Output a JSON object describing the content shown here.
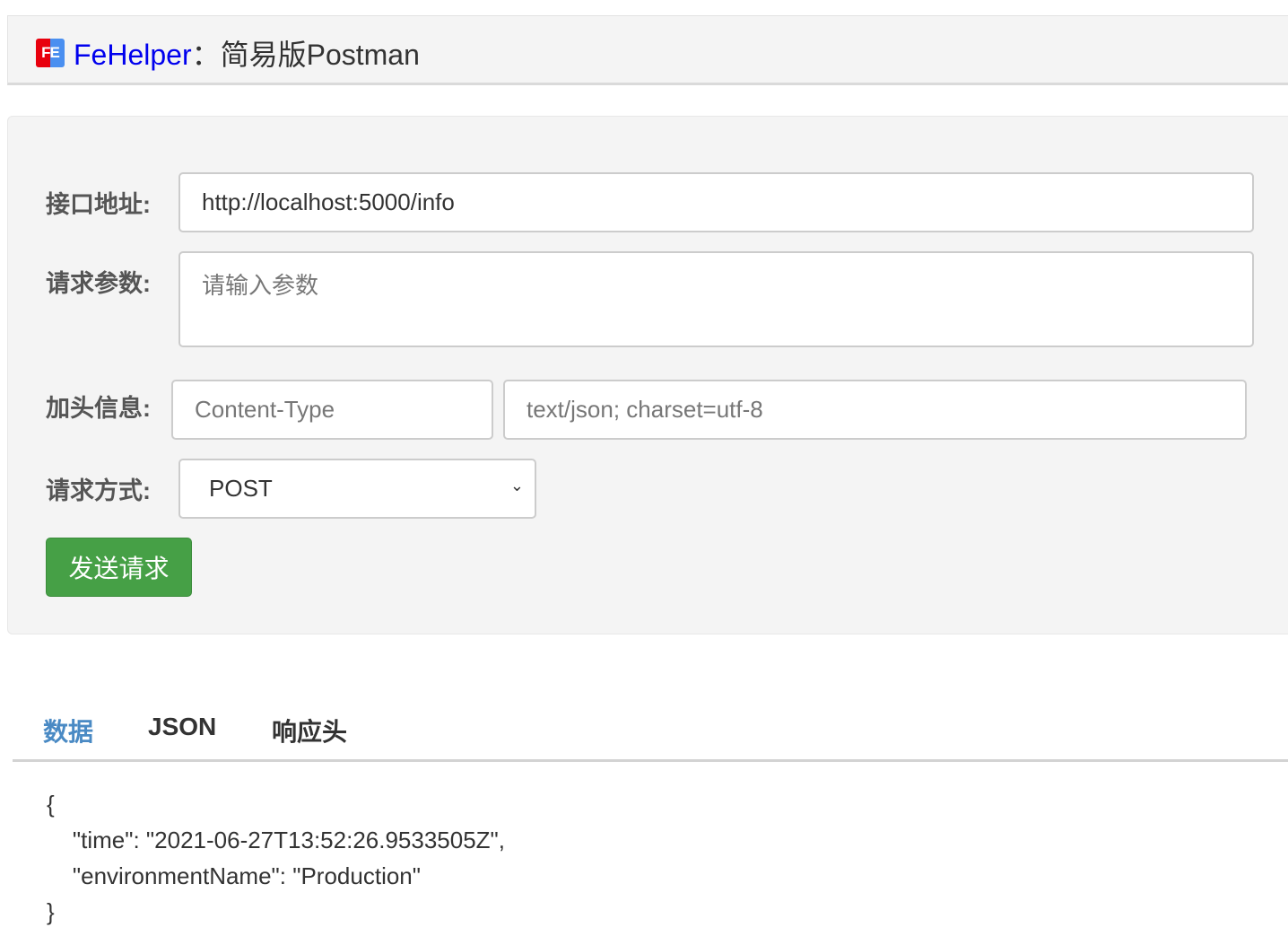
{
  "header": {
    "logo": "FE",
    "brand": "FeHelper",
    "title": "：简易版Postman"
  },
  "form": {
    "url_label": "接口地址:",
    "url_value": "http://localhost:5000/info",
    "params_label": "请求参数:",
    "params_placeholder": "请输入参数",
    "header_label": "加头信息:",
    "header_key": "Content-Type",
    "header_value": "text/json; charset=utf-8",
    "method_label": "请求方式:",
    "method_value": "POST",
    "send_label": "发送请求"
  },
  "tabs": [
    {
      "label": "数据",
      "active": true
    },
    {
      "label": "JSON"
    },
    {
      "label": "响应头"
    }
  ],
  "response": {
    "lines": [
      "{",
      "    \"time\": \"2021-06-27T13:52:26.9533505Z\",",
      "    \"environmentName\": \"Production\"",
      "}"
    ]
  },
  "colors": {
    "brand": "#0000ee",
    "active_tab": "#4a8ac4",
    "send_button": "#46a046"
  }
}
